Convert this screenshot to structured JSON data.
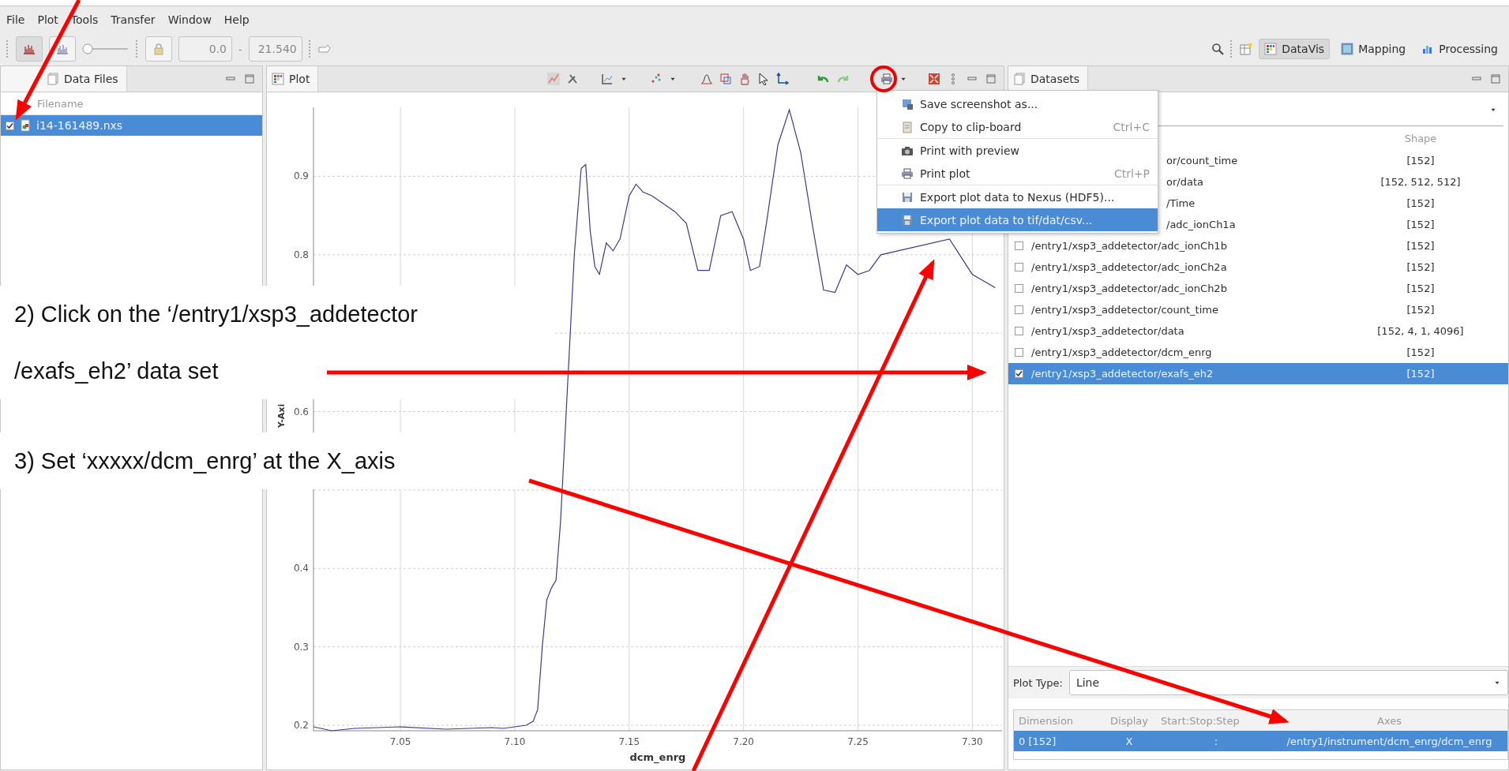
{
  "menu_bar": [
    "File",
    "Plot",
    "Tools",
    "Transfer",
    "Window",
    "Help"
  ],
  "toolbar": {
    "zoom_slider": {
      "level": 0
    },
    "range_start": "0.0",
    "range_separator": "-",
    "range_end": "21.540",
    "perspectives": [
      {
        "label": "DataVis",
        "selected": true
      },
      {
        "label": "Mapping",
        "selected": false
      },
      {
        "label": "Processing",
        "selected": false
      }
    ]
  },
  "data_files": {
    "title": "Data Files",
    "column": "Filename",
    "files": [
      {
        "name": "i14-161489.nxs",
        "checked": true,
        "selected": true
      }
    ]
  },
  "plot": {
    "title": "Plot",
    "chart_data": {
      "type": "line",
      "xlabel": "dcm_enrg",
      "ylabel": "Y-Axi",
      "xlim": [
        7.012,
        7.313
      ],
      "ylim": [
        0.193,
        0.988
      ],
      "grid": true,
      "xticks": [
        {
          "value": 7.05,
          "label": "7.05"
        },
        {
          "value": 7.1,
          "label": "7.10"
        },
        {
          "value": 7.15,
          "label": "7.15"
        },
        {
          "value": 7.2,
          "label": "7.20"
        },
        {
          "value": 7.25,
          "label": "7.25"
        },
        {
          "value": 7.3,
          "label": "7.30"
        }
      ],
      "yticks": [
        0.2,
        0.3,
        0.4,
        0.6,
        0.8,
        0.9
      ],
      "x": [
        7.012,
        7.02,
        7.03,
        7.05,
        7.07,
        7.09,
        7.095,
        7.1,
        7.105,
        7.108,
        7.11,
        7.112,
        7.114,
        7.116,
        7.118,
        7.12,
        7.123,
        7.126,
        7.129,
        7.131,
        7.133,
        7.135,
        7.137,
        7.14,
        7.143,
        7.146,
        7.15,
        7.153,
        7.156,
        7.16,
        7.17,
        7.175,
        7.18,
        7.185,
        7.19,
        7.195,
        7.2,
        7.203,
        7.207,
        7.21,
        7.215,
        7.22,
        7.225,
        7.23,
        7.235,
        7.24,
        7.245,
        7.25,
        7.255,
        7.26,
        7.29,
        7.3,
        7.31
      ],
      "series": [
        {
          "color": "#3c3c8c",
          "values": [
            0.198,
            0.193,
            0.196,
            0.198,
            0.195,
            0.197,
            0.196,
            0.198,
            0.2,
            0.205,
            0.22,
            0.3,
            0.36,
            0.375,
            0.385,
            0.46,
            0.63,
            0.8,
            0.91,
            0.915,
            0.83,
            0.785,
            0.775,
            0.815,
            0.805,
            0.82,
            0.875,
            0.89,
            0.88,
            0.875,
            0.855,
            0.84,
            0.78,
            0.78,
            0.85,
            0.855,
            0.82,
            0.78,
            0.785,
            0.84,
            0.94,
            0.985,
            0.93,
            0.84,
            0.755,
            0.752,
            0.787,
            0.775,
            0.78,
            0.8,
            0.82,
            0.775,
            0.758
          ]
        }
      ]
    }
  },
  "plot_menu": {
    "items": [
      {
        "label": "Save screenshot as...",
        "selected": false,
        "separator_after": false
      },
      {
        "label": "Copy to clip-board",
        "shortcut": "Ctrl+C",
        "selected": false,
        "separator_after": true
      },
      {
        "label": "Print with preview",
        "selected": false,
        "separator_after": false
      },
      {
        "label": "Print plot",
        "shortcut": "Ctrl+P",
        "selected": false,
        "separator_after": true
      },
      {
        "label": "Export plot data to Nexus (HDF5)...",
        "selected": false,
        "separator_after": false
      },
      {
        "label": "Export plot data to tif/dat/csv...",
        "selected": true,
        "separator_after": false
      }
    ]
  },
  "datasets": {
    "title": "Datasets",
    "shape_column": "Shape",
    "rows": [
      {
        "kind": "partial",
        "name": "or/count_time",
        "shape": "[152]"
      },
      {
        "kind": "partial",
        "name": "or/data",
        "shape": "[152, 512, 512]"
      },
      {
        "kind": "partial",
        "name": "/Time",
        "shape": "[152]"
      },
      {
        "kind": "partial",
        "name": "/adc_ionCh1a",
        "shape": "[152]"
      },
      {
        "kind": "full",
        "name": "/entry1/xsp3_addetector/adc_ionCh1b",
        "shape": "[152]",
        "checked": false,
        "selected": false
      },
      {
        "kind": "full",
        "name": "/entry1/xsp3_addetector/adc_ionCh2a",
        "shape": "[152]",
        "checked": false,
        "selected": false
      },
      {
        "kind": "full",
        "name": "/entry1/xsp3_addetector/adc_ionCh2b",
        "shape": "[152]",
        "checked": false,
        "selected": false
      },
      {
        "kind": "full",
        "name": "/entry1/xsp3_addetector/count_time",
        "shape": "[152]",
        "checked": false,
        "selected": false
      },
      {
        "kind": "full",
        "name": "/entry1/xsp3_addetector/data",
        "shape": "[152, 4, 1, 4096]",
        "checked": false,
        "selected": false
      },
      {
        "kind": "full",
        "name": "/entry1/xsp3_addetector/dcm_enrg",
        "shape": "[152]",
        "checked": false,
        "selected": false
      },
      {
        "kind": "full",
        "name": "/entry1/xsp3_addetector/exafs_eh2",
        "shape": "[152]",
        "checked": true,
        "selected": true
      }
    ],
    "plot_type_label": "Plot Type:",
    "plot_type": "Line",
    "dimensions": {
      "columns": [
        "Dimension",
        "Display",
        "Start:Stop:Step",
        "Axes"
      ],
      "rows": [
        {
          "dimension": "0 [152]",
          "display": "X",
          "range": ":",
          "axes": "/entry1/instrument/dcm_enrg/dcm_enrg",
          "selected": true
        }
      ]
    }
  },
  "annotations": [
    {
      "lines": [
        "2) Click on the ‘/entry1/xsp3_addetector",
        "/exafs_eh2’ data set"
      ]
    },
    {
      "lines": [
        "3) Set ‘xxxxx/dcm_enrg’ at the X_axis"
      ]
    }
  ]
}
